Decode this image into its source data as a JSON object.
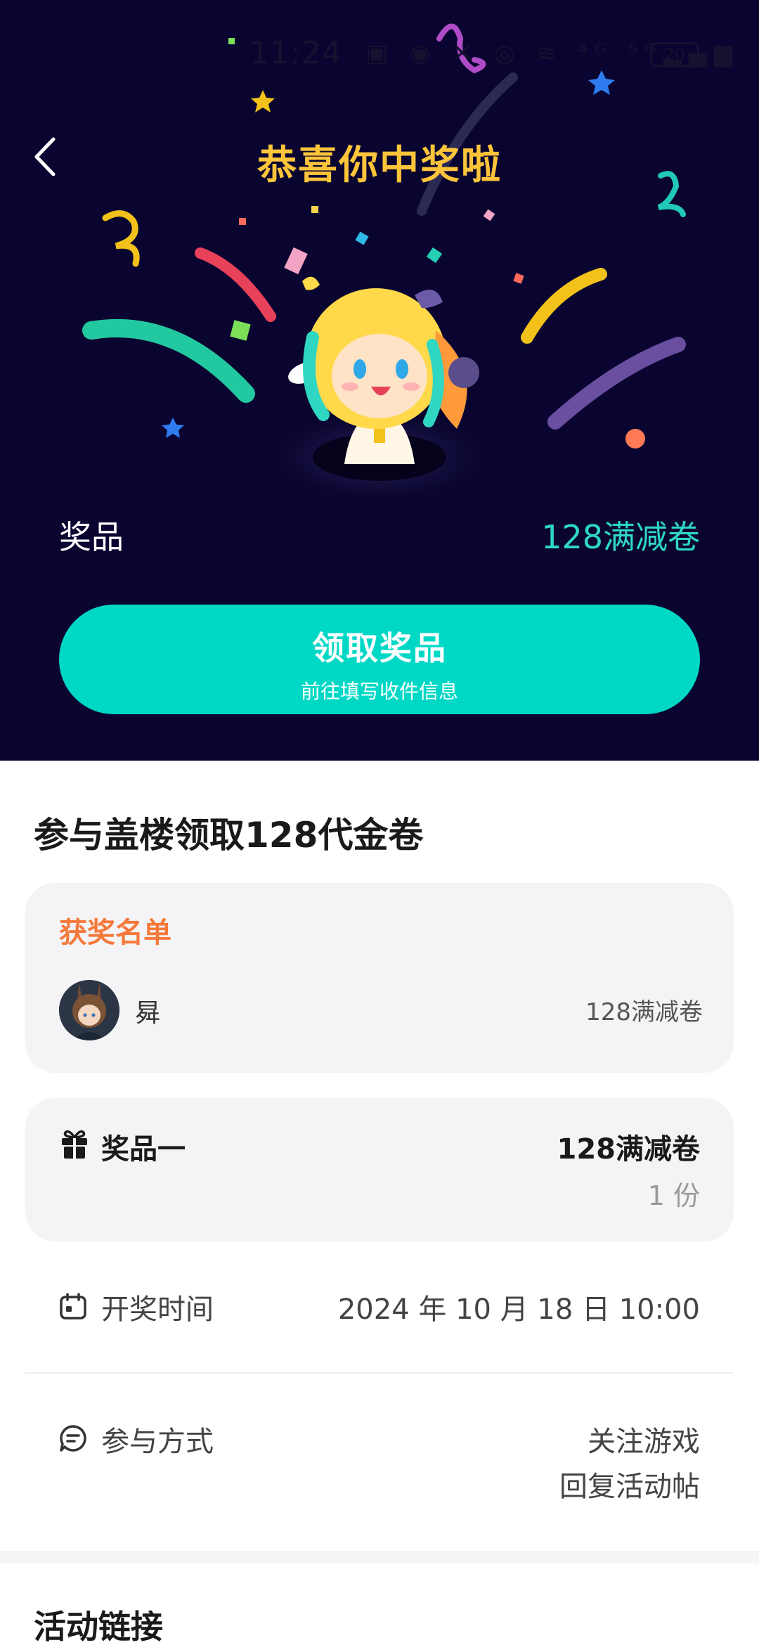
{
  "status_bar": {
    "time": "11:24",
    "icons_text": "▣ ◉ ✕ ◎ ≋ ⁴ᴳ ⁵ᴳ▂▄▆",
    "battery": "20"
  },
  "header": {
    "title": "恭喜你中奖啦"
  },
  "prize_summary": {
    "label": "奖品",
    "value": "128满减卷"
  },
  "claim_button": {
    "label": "领取奖品",
    "sublabel": "前往填写收件信息"
  },
  "activity": {
    "title": "参与盖楼领取128代金卷"
  },
  "winners": {
    "title": "获奖名单",
    "items": [
      {
        "name": "曻",
        "prize": "128满减卷"
      }
    ]
  },
  "prize_card": {
    "name": "奖品一",
    "value": "128满减卷",
    "count": "1 份"
  },
  "draw_time": {
    "label": "开奖时间",
    "value": "2024 年 10 月 18 日 10:00"
  },
  "participation": {
    "label": "参与方式",
    "methods": [
      "关注游戏",
      "回复活动帖"
    ]
  },
  "links": {
    "title": "活动链接"
  },
  "colors": {
    "hero_bg": "#0a0530",
    "title_gold": "#ffc53a",
    "accent_teal": "#00d8c6",
    "winners_orange": "#f5793b"
  },
  "icons": [
    "back-arrow-icon",
    "gift-icon",
    "calendar-icon",
    "chat-bubble-icon"
  ]
}
